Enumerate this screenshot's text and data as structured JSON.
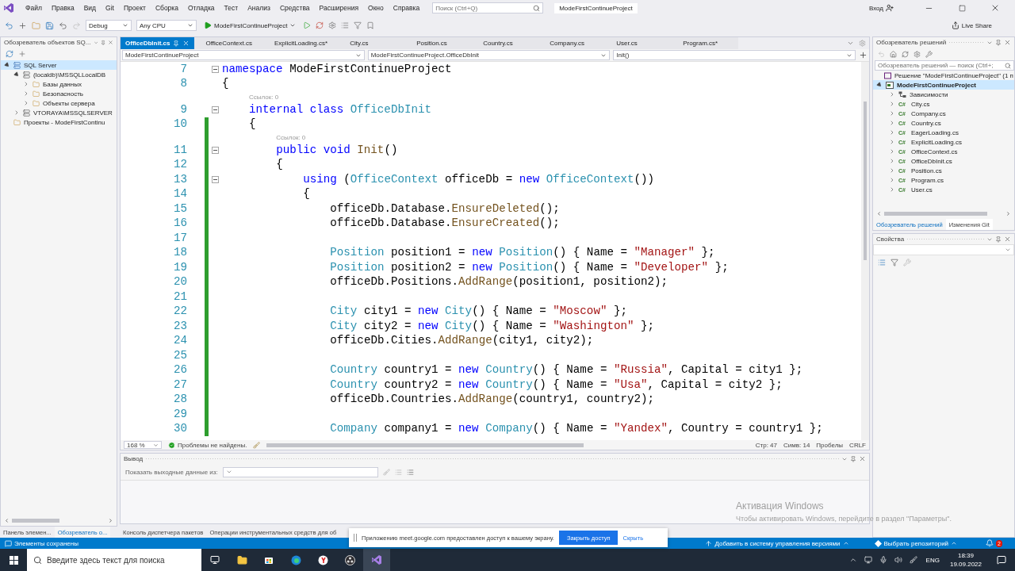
{
  "menu": {
    "items": [
      "Файл",
      "Правка",
      "Вид",
      "Git",
      "Проект",
      "Сборка",
      "Отладка",
      "Тест",
      "Анализ",
      "Средства",
      "Расширения",
      "Окно",
      "Справка"
    ],
    "search": {
      "placeholder": "Поиск (Ctrl+Q)"
    },
    "project": "ModeFirstContinueProject",
    "account": "Вход"
  },
  "toolbar": {
    "configuration": "Debug",
    "platform": "Any CPU",
    "run": "ModeFirstContinueProject",
    "live_share": "Live Share"
  },
  "sql_explorer": {
    "title": "Обозреватель объектов SQ...",
    "tree": [
      {
        "label": "SQL Server",
        "kind": "group",
        "expanded": true,
        "selected": true,
        "children": [
          {
            "label": "(localdb)\\MSSQLLocalDB",
            "kind": "server",
            "expanded": true,
            "selected": false,
            "children": [
              {
                "label": "Базы данных",
                "kind": "folder",
                "expanded": false,
                "selected": false
              },
              {
                "label": "Безопасность",
                "kind": "folder",
                "expanded": false,
                "selected": false
              },
              {
                "label": "Объекты сервера",
                "kind": "folder",
                "expanded": false,
                "selected": false
              }
            ]
          },
          {
            "label": "VTORAYA\\MSSQLSERVER",
            "kind": "server",
            "expanded": false,
            "selected": false
          }
        ]
      },
      {
        "label": "Проекты - ModeFirstContinu",
        "kind": "folder",
        "selected": false
      }
    ],
    "tabs": [
      {
        "label": "Панель элемен...",
        "selected": false
      },
      {
        "label": "Обозреватель о...",
        "selected": true
      }
    ]
  },
  "editor": {
    "tabs": [
      {
        "label": "OfficeDbInit.cs",
        "selected": true
      },
      {
        "label": "OfficeContext.cs",
        "selected": false
      },
      {
        "label": "ExplicitLoading.cs*",
        "selected": false
      },
      {
        "label": "City.cs",
        "selected": false
      },
      {
        "label": "Position.cs",
        "selected": false
      },
      {
        "label": "Country.cs",
        "selected": false
      },
      {
        "label": "Company.cs",
        "selected": false
      },
      {
        "label": "User.cs",
        "selected": false
      },
      {
        "label": "Program.cs*",
        "selected": false
      }
    ],
    "nav": [
      "ModeFirstContinueProject",
      "ModeFirstContinueProject.OfficeDbInit",
      "Init()"
    ],
    "lines": [
      {
        "kind": "code",
        "number": "7",
        "foldable": true,
        "changed": false,
        "tokens": [
          {
            "kind": "kw",
            "text": "namespace"
          },
          {
            "kind": "plain",
            "text": " ModeFirstContinueProject"
          }
        ]
      },
      {
        "kind": "code",
        "number": "8",
        "foldable": false,
        "changed": false,
        "tokens": [
          {
            "kind": "plain",
            "text": "{"
          }
        ]
      },
      {
        "kind": "block",
        "children": [
          {
            "kind": "hint",
            "text": "Ссылок: 0",
            "changed": false
          },
          {
            "kind": "code",
            "number": "9",
            "foldable": true,
            "changed": false,
            "tokens": [
              {
                "kind": "kw",
                "text": "internal class"
              },
              {
                "kind": "type",
                "text": " OfficeDbInit"
              }
            ]
          },
          {
            "kind": "code",
            "number": "10",
            "foldable": false,
            "changed": true,
            "tokens": [
              {
                "kind": "plain",
                "text": "{"
              }
            ]
          },
          {
            "kind": "block",
            "children": [
              {
                "kind": "hint",
                "text": "Ссылок: 0",
                "changed": true
              },
              {
                "kind": "code",
                "number": "11",
                "foldable": true,
                "changed": true,
                "tokens": [
                  {
                    "kind": "kw",
                    "text": "public void"
                  },
                  {
                    "kind": "method",
                    "text": " Init"
                  },
                  {
                    "kind": "plain",
                    "text": "()"
                  }
                ]
              },
              {
                "kind": "code",
                "number": "12",
                "foldable": false,
                "changed": true,
                "tokens": [
                  {
                    "kind": "plain",
                    "text": "{"
                  }
                ]
              },
              {
                "kind": "block",
                "children": [
                  {
                    "kind": "code",
                    "number": "13",
                    "foldable": true,
                    "changed": true,
                    "tokens": [
                      {
                        "kind": "kw",
                        "text": "using"
                      },
                      {
                        "kind": "plain",
                        "text": " ("
                      },
                      {
                        "kind": "type",
                        "text": "OfficeContext"
                      },
                      {
                        "kind": "plain",
                        "text": " officeDb = "
                      },
                      {
                        "kind": "kw",
                        "text": "new"
                      },
                      {
                        "kind": "type",
                        "text": " OfficeContext"
                      },
                      {
                        "kind": "plain",
                        "text": "())"
                      }
                    ]
                  },
                  {
                    "kind": "code",
                    "number": "14",
                    "foldable": false,
                    "changed": true,
                    "tokens": [
                      {
                        "kind": "plain",
                        "text": "{"
                      }
                    ]
                  },
                  {
                    "kind": "block",
                    "children": [
                      {
                        "kind": "code",
                        "number": "15",
                        "foldable": false,
                        "changed": true,
                        "tokens": [
                          {
                            "kind": "plain",
                            "text": "officeDb.Database."
                          },
                          {
                            "kind": "method",
                            "text": "EnsureDeleted"
                          },
                          {
                            "kind": "plain",
                            "text": "();"
                          }
                        ]
                      },
                      {
                        "kind": "code",
                        "number": "16",
                        "foldable": false,
                        "changed": true,
                        "tokens": [
                          {
                            "kind": "plain",
                            "text": "officeDb.Database."
                          },
                          {
                            "kind": "method",
                            "text": "EnsureCreated"
                          },
                          {
                            "kind": "plain",
                            "text": "();"
                          }
                        ]
                      },
                      {
                        "kind": "code",
                        "number": "17",
                        "foldable": false,
                        "changed": true
                      },
                      {
                        "kind": "code",
                        "number": "18",
                        "foldable": false,
                        "changed": true,
                        "tokens": [
                          {
                            "kind": "type",
                            "text": "Position"
                          },
                          {
                            "kind": "plain",
                            "text": " position1 = "
                          },
                          {
                            "kind": "kw",
                            "text": "new"
                          },
                          {
                            "kind": "type",
                            "text": " Position"
                          },
                          {
                            "kind": "plain",
                            "text": "() { Name = "
                          },
                          {
                            "kind": "string",
                            "text": "\"Manager\""
                          },
                          {
                            "kind": "plain",
                            "text": " };"
                          }
                        ]
                      },
                      {
                        "kind": "code",
                        "number": "19",
                        "foldable": false,
                        "changed": true,
                        "tokens": [
                          {
                            "kind": "type",
                            "text": "Position"
                          },
                          {
                            "kind": "plain",
                            "text": " position2 = "
                          },
                          {
                            "kind": "kw",
                            "text": "new"
                          },
                          {
                            "kind": "type",
                            "text": " Position"
                          },
                          {
                            "kind": "plain",
                            "text": "() { Name = "
                          },
                          {
                            "kind": "string",
                            "text": "\"Developer\""
                          },
                          {
                            "kind": "plain",
                            "text": " };"
                          }
                        ]
                      },
                      {
                        "kind": "code",
                        "number": "20",
                        "foldable": false,
                        "changed": true,
                        "tokens": [
                          {
                            "kind": "plain",
                            "text": "officeDb.Positions."
                          },
                          {
                            "kind": "method",
                            "text": "AddRange"
                          },
                          {
                            "kind": "plain",
                            "text": "(position1, position2);"
                          }
                        ]
                      },
                      {
                        "kind": "code",
                        "number": "21",
                        "foldable": false,
                        "changed": true
                      },
                      {
                        "kind": "code",
                        "number": "22",
                        "foldable": false,
                        "changed": true,
                        "tokens": [
                          {
                            "kind": "type",
                            "text": "City"
                          },
                          {
                            "kind": "plain",
                            "text": " city1 = "
                          },
                          {
                            "kind": "kw",
                            "text": "new"
                          },
                          {
                            "kind": "type",
                            "text": " City"
                          },
                          {
                            "kind": "plain",
                            "text": "() { Name = "
                          },
                          {
                            "kind": "string",
                            "text": "\"Moscow\""
                          },
                          {
                            "kind": "plain",
                            "text": " };"
                          }
                        ]
                      },
                      {
                        "kind": "code",
                        "number": "23",
                        "foldable": false,
                        "changed": true,
                        "tokens": [
                          {
                            "kind": "type",
                            "text": "City"
                          },
                          {
                            "kind": "plain",
                            "text": " city2 = "
                          },
                          {
                            "kind": "kw",
                            "text": "new"
                          },
                          {
                            "kind": "type",
                            "text": " City"
                          },
                          {
                            "kind": "plain",
                            "text": "() { Name = "
                          },
                          {
                            "kind": "string",
                            "text": "\"Washington\""
                          },
                          {
                            "kind": "plain",
                            "text": " };"
                          }
                        ]
                      },
                      {
                        "kind": "code",
                        "number": "24",
                        "foldable": false,
                        "changed": true,
                        "tokens": [
                          {
                            "kind": "plain",
                            "text": "officeDb.Cities."
                          },
                          {
                            "kind": "method",
                            "text": "AddRange"
                          },
                          {
                            "kind": "plain",
                            "text": "(city1, city2);"
                          }
                        ]
                      },
                      {
                        "kind": "code",
                        "number": "25",
                        "foldable": false,
                        "changed": true
                      },
                      {
                        "kind": "code",
                        "number": "26",
                        "foldable": false,
                        "changed": true,
                        "tokens": [
                          {
                            "kind": "type",
                            "text": "Country"
                          },
                          {
                            "kind": "plain",
                            "text": " country1 = "
                          },
                          {
                            "kind": "kw",
                            "text": "new"
                          },
                          {
                            "kind": "type",
                            "text": " Country"
                          },
                          {
                            "kind": "plain",
                            "text": "() { Name = "
                          },
                          {
                            "kind": "string",
                            "text": "\"Russia\""
                          },
                          {
                            "kind": "plain",
                            "text": ", Capital = city1 };"
                          }
                        ]
                      },
                      {
                        "kind": "code",
                        "number": "27",
                        "foldable": false,
                        "changed": true,
                        "tokens": [
                          {
                            "kind": "type",
                            "text": "Country"
                          },
                          {
                            "kind": "plain",
                            "text": " country2 = "
                          },
                          {
                            "kind": "kw",
                            "text": "new"
                          },
                          {
                            "kind": "type",
                            "text": " Country"
                          },
                          {
                            "kind": "plain",
                            "text": "() { Name = "
                          },
                          {
                            "kind": "string",
                            "text": "\"Usa\""
                          },
                          {
                            "kind": "plain",
                            "text": ", Capital = city2 };"
                          }
                        ]
                      },
                      {
                        "kind": "code",
                        "number": "28",
                        "foldable": false,
                        "changed": true,
                        "tokens": [
                          {
                            "kind": "plain",
                            "text": "officeDb.Countries."
                          },
                          {
                            "kind": "method",
                            "text": "AddRange"
                          },
                          {
                            "kind": "plain",
                            "text": "(country1, country2);"
                          }
                        ]
                      },
                      {
                        "kind": "code",
                        "number": "29",
                        "foldable": false,
                        "changed": true
                      },
                      {
                        "kind": "code",
                        "number": "30",
                        "foldable": false,
                        "changed": true,
                        "tokens": [
                          {
                            "kind": "type",
                            "text": "Company"
                          },
                          {
                            "kind": "plain",
                            "text": " company1 = "
                          },
                          {
                            "kind": "kw",
                            "text": "new"
                          },
                          {
                            "kind": "type",
                            "text": " Company"
                          },
                          {
                            "kind": "plain",
                            "text": "() { Name = "
                          },
                          {
                            "kind": "string",
                            "text": "\"Yandex\""
                          },
                          {
                            "kind": "plain",
                            "text": ", Country = country1 };"
                          }
                        ]
                      }
                    ]
                  }
                ]
              }
            ]
          }
        ]
      }
    ],
    "status": {
      "zoom": "168 %",
      "problems": "Проблемы не найдены.",
      "line": "Стр: 47",
      "column": "Симв: 14",
      "whitespace": "Пробелы",
      "line_ending": "CRLF"
    }
  },
  "output": {
    "title": "Вывод",
    "source_label": "Показать выходные данные из:"
  },
  "bottom_tabs": [
    {
      "label": "Консоль диспетчера пакетов",
      "selected": false
    },
    {
      "label": "Операции инструментальных средств для об",
      "selected": false
    }
  ],
  "solution_explorer": {
    "title": "Обозреватель решений",
    "search": {
      "placeholder": "Обозреватель решений — поиск (Ctrl+;"
    },
    "solution": "Решение \"ModeFirstContinueProject\" (1 п",
    "project": {
      "label": "ModeFirstContinueProject",
      "expanded": true,
      "selected": true,
      "children": [
        {
          "label": "Зависимости",
          "kind": "deps",
          "expanded": false
        },
        {
          "label": "City.cs",
          "kind": "cs",
          "icon_text": "C#",
          "expanded": false
        },
        {
          "label": "Company.cs",
          "kind": "cs",
          "icon_text": "C#",
          "expanded": false
        },
        {
          "label": "Country.cs",
          "kind": "cs",
          "icon_text": "C#",
          "expanded": false
        },
        {
          "label": "EagerLoading.cs",
          "kind": "cs",
          "icon_text": "C#",
          "expanded": false
        },
        {
          "label": "ExplicitLoading.cs",
          "kind": "cs",
          "icon_text": "C#",
          "expanded": false
        },
        {
          "label": "OfficeContext.cs",
          "kind": "cs",
          "icon_text": "C#",
          "expanded": false
        },
        {
          "label": "OfficeDbInit.cs",
          "kind": "cs",
          "icon_text": "C#",
          "expanded": false
        },
        {
          "label": "Position.cs",
          "kind": "cs",
          "icon_text": "C#",
          "expanded": false
        },
        {
          "label": "Program.cs",
          "kind": "cs",
          "icon_text": "C#",
          "expanded": false
        },
        {
          "label": "User.cs",
          "kind": "cs",
          "icon_text": "C#",
          "expanded": false
        }
      ]
    },
    "tabs": [
      {
        "label": "Обозреватель решений",
        "selected": true
      },
      {
        "label": "Изменения Git",
        "selected": false
      }
    ]
  },
  "properties": {
    "title": "Свойства"
  },
  "status_bar": {
    "message": "Элементы сохранены",
    "source_control": "Добавить в систему управления версиями",
    "repository": "Выбрать репозиторий",
    "notifications": "2"
  },
  "share_popup": {
    "text": "Приложению meet.google.com предоставлен доступ к вашему экрану.",
    "stop": "Закрыть доступ",
    "hide": "Скрыть"
  },
  "activation": {
    "title": "Активация Windows",
    "text": "Чтобы активировать Windows, перейдите в раздел \"Параметры\"."
  },
  "taskbar": {
    "search": {
      "placeholder": "Введите здесь текст для поиска"
    },
    "language": "ENG",
    "time": "18:39",
    "date": "19.09.2022"
  }
}
